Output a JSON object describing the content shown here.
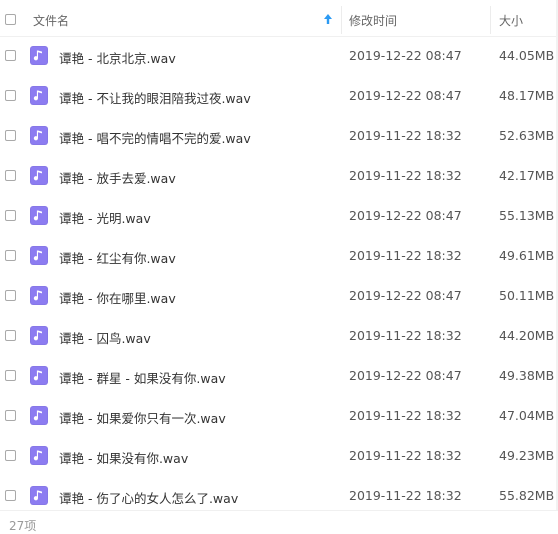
{
  "header": {
    "name_label": "文件名",
    "date_label": "修改时间",
    "size_label": "大小",
    "sort_icon": "sort-ascending-arrow-icon",
    "accent_color": "#2b9af3"
  },
  "file_icon": {
    "name": "audio-file-icon",
    "color": "#8c7cf1"
  },
  "files": [
    {
      "name": "谭艳 - 北京北京.wav",
      "date": "2019-12-22 08:47",
      "size": "44.05MB"
    },
    {
      "name": "谭艳 - 不让我的眼泪陪我过夜.wav",
      "date": "2019-12-22 08:47",
      "size": "48.17MB"
    },
    {
      "name": "谭艳 - 唱不完的情唱不完的爱.wav",
      "date": "2019-11-22 18:32",
      "size": "52.63MB"
    },
    {
      "name": "谭艳 - 放手去爱.wav",
      "date": "2019-11-22 18:32",
      "size": "42.17MB"
    },
    {
      "name": "谭艳 - 光明.wav",
      "date": "2019-12-22 08:47",
      "size": "55.13MB"
    },
    {
      "name": "谭艳 - 红尘有你.wav",
      "date": "2019-11-22 18:32",
      "size": "49.61MB"
    },
    {
      "name": "谭艳 - 你在哪里.wav",
      "date": "2019-12-22 08:47",
      "size": "50.11MB"
    },
    {
      "name": "谭艳 - 囚鸟.wav",
      "date": "2019-11-22 18:32",
      "size": "44.20MB"
    },
    {
      "name": "谭艳 - 群星 - 如果没有你.wav",
      "date": "2019-12-22 08:47",
      "size": "49.38MB"
    },
    {
      "name": "谭艳 - 如果爱你只有一次.wav",
      "date": "2019-11-22 18:32",
      "size": "47.04MB"
    },
    {
      "name": "谭艳 - 如果没有你.wav",
      "date": "2019-11-22 18:32",
      "size": "49.23MB"
    },
    {
      "name": "谭艳 - 伤了心的女人怎么了.wav",
      "date": "2019-11-22 18:32",
      "size": "55.82MB"
    }
  ],
  "footer": {
    "count_label": "27项"
  }
}
